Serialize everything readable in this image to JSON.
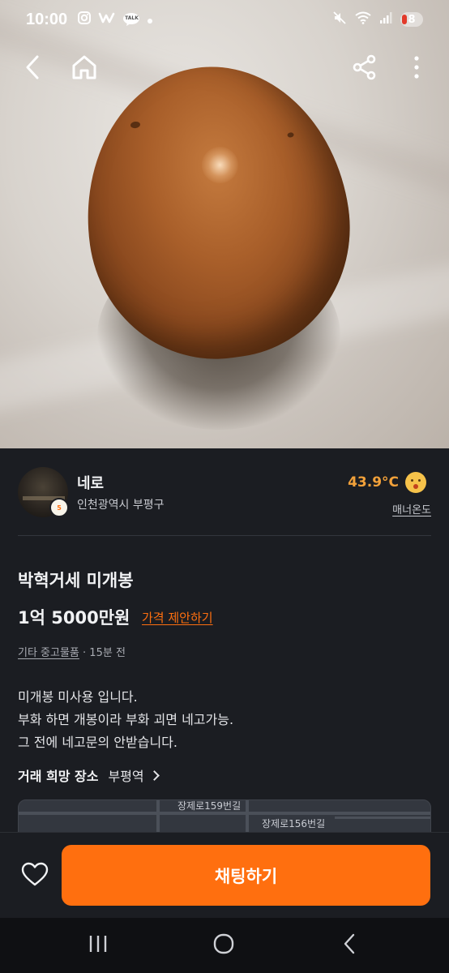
{
  "status_bar": {
    "time": "10:00",
    "icons": [
      "instagram-icon",
      "w-app-icon",
      "kakaotalk-icon",
      "dot-icon",
      "mute-icon",
      "wifi-icon",
      "signal-icon"
    ],
    "talk_label": "TALK",
    "battery": "8"
  },
  "top_nav": {
    "back_icon": "chevron-left-icon",
    "home_icon": "home-icon",
    "share_icon": "share-icon",
    "more_icon": "more-vertical-icon"
  },
  "seller": {
    "name": "네로",
    "location": "인천광역시 부평구",
    "temperature": "43.9°C",
    "manner_label": "매너온도",
    "badge_text": "5"
  },
  "product": {
    "title": "박혁거세 미개봉",
    "price": "1억 5000만원",
    "offer_label": "가격 제안하기",
    "category": "기타 중고물품",
    "time_ago": "· 15분 전",
    "description": [
      "미개봉 미사용 입니다.",
      "부화 하면 개봉이라 부화 괴면 네고가능.",
      "그 전에 네고문의 안받습니다."
    ]
  },
  "place": {
    "label": "거래 희망 장소",
    "value": "부평역"
  },
  "map": {
    "labels": [
      "장제로159번길",
      "장제로156번길"
    ]
  },
  "actions": {
    "chat_label": "채팅하기"
  },
  "colors": {
    "accent": "#ff6f0f",
    "temperature": "#f2a13a",
    "background": "#1b1d22"
  }
}
